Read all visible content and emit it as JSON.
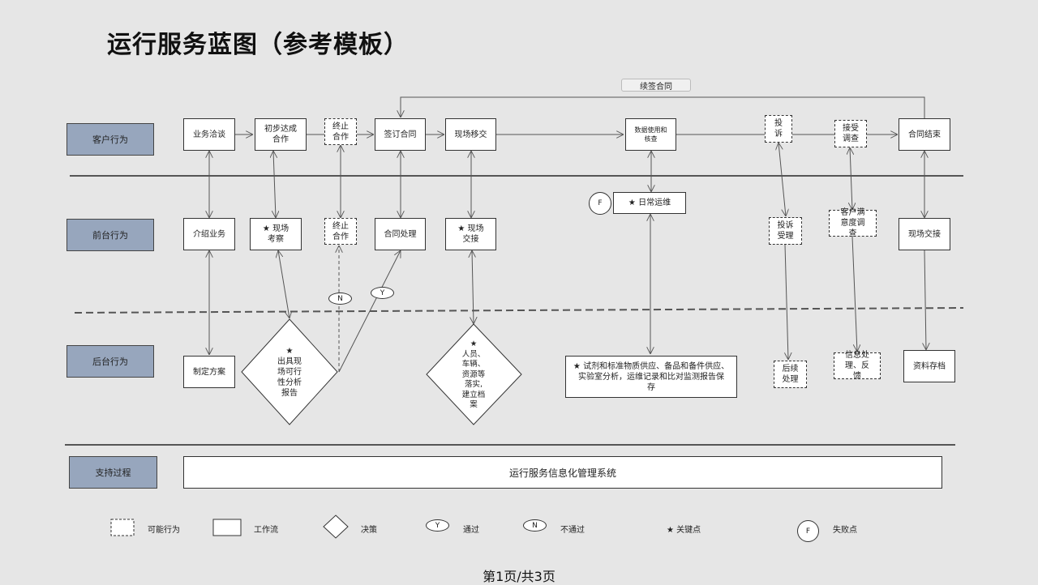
{
  "title": "运行服务蓝图（参考模板）",
  "lanes": {
    "customer": "客户行为",
    "front": "前台行为",
    "back": "后台行为",
    "support": "支持过程"
  },
  "renew_label": "续签合同",
  "customer_row": {
    "c1": "业务洽谈",
    "c2": "初步达成\n合作",
    "c3": "终止\n合作",
    "c4": "签订合同",
    "c5": "现场移交",
    "c6": "数据使用和\n核查",
    "c7": "投\n诉",
    "c8": "接受\n调查",
    "c9": "合同结束"
  },
  "front_row": {
    "f1": "介绍业务",
    "f2": "★  现场\n考察",
    "f3": "终止\n合作",
    "f4": "合同处理",
    "f5": "★ 现场\n交接",
    "f6": "★  日常运维",
    "f7": "投诉\n受理",
    "f8": "客户满\n意度调\n查",
    "f9": "现场交接"
  },
  "back_row": {
    "b1": "制定方案",
    "d1": "★\n出具现\n场可行\n性分析\n报告",
    "d2": "★\n人员、\n车辆、\n资源等\n落实,\n建立档\n案",
    "b3": "★  试剂和标准物质供应、备品和备件供应、\n实验室分析，运维记录和比对监测报告保\n存",
    "b4": "后续\n处理",
    "b5": "信息处\n理、反\n馈",
    "b6": "资料存档"
  },
  "markers": {
    "yes": "Y",
    "no": "N",
    "fail": "F"
  },
  "support_text": "运行服务信息化管理系统",
  "legend": {
    "possible": "可能行为",
    "workflow": "工作流",
    "decision": "决策",
    "pass_symbol": "Y",
    "pass": "通过",
    "fail_symbol": "N",
    "nopass": "不通过",
    "key": "★ 关键点",
    "failpoint_symbol": "F",
    "failpoint": "失败点"
  },
  "page_indicator": "第1页/共3页"
}
